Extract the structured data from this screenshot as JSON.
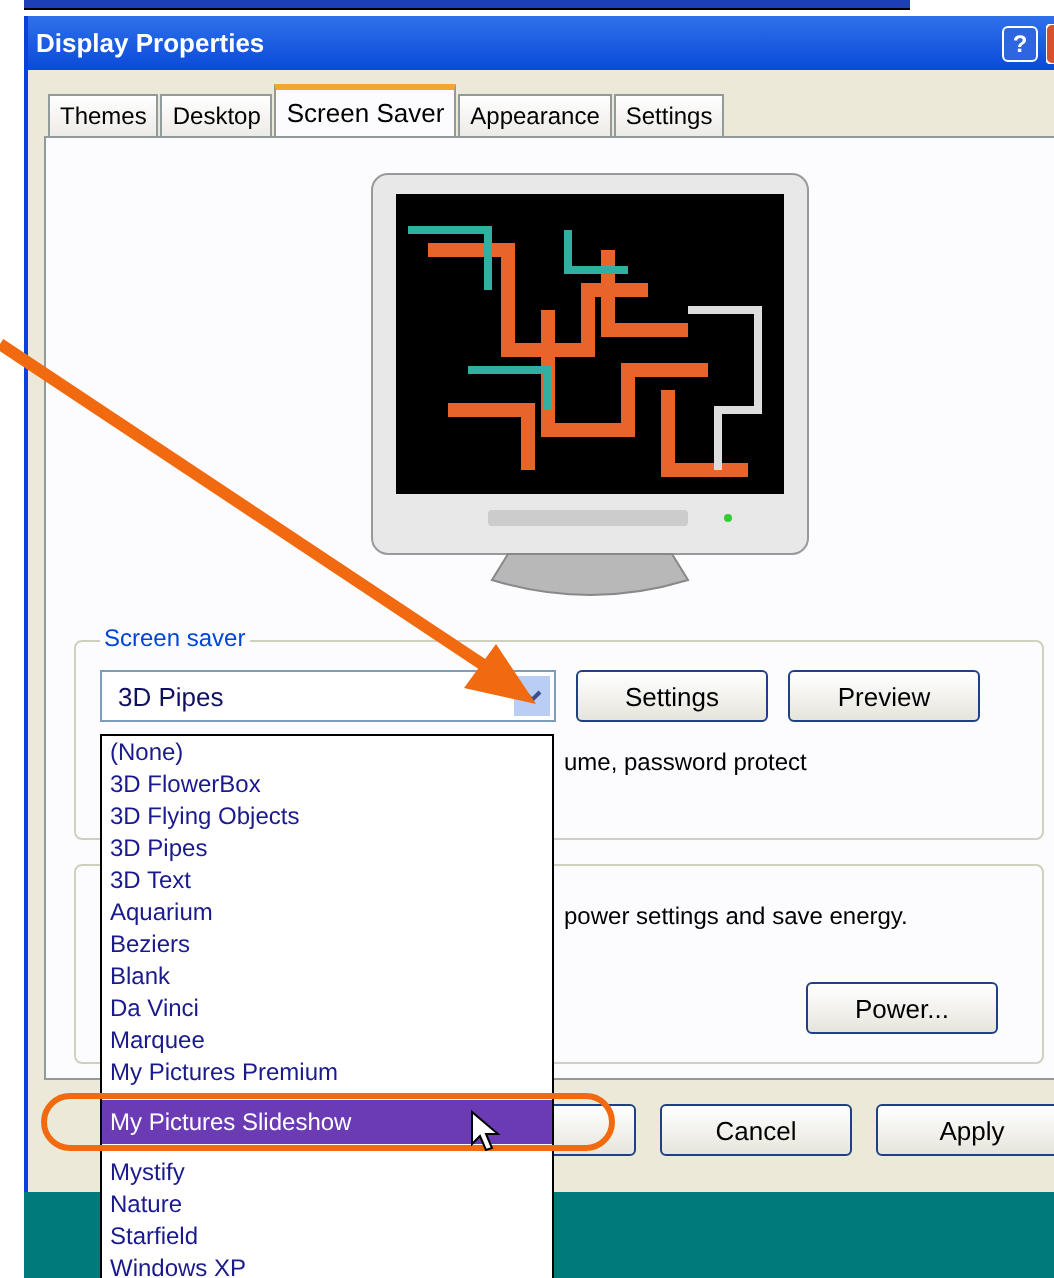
{
  "window": {
    "title": "Display Properties",
    "help_button": "?"
  },
  "tabs": [
    {
      "label": "Themes",
      "selected": false
    },
    {
      "label": "Desktop",
      "selected": false
    },
    {
      "label": "Screen Saver",
      "selected": true
    },
    {
      "label": "Appearance",
      "selected": false
    },
    {
      "label": "Settings",
      "selected": false
    }
  ],
  "screen_saver": {
    "group_label": "Screen saver",
    "value": "3D Pipes",
    "buttons": [
      "Settings",
      "Preview"
    ],
    "hint_text": "ume, password protect"
  },
  "dropdown_list": [
    {
      "label": "(None)",
      "selected": false
    },
    {
      "label": "3D FlowerBox",
      "selected": false
    },
    {
      "label": "3D Flying Objects",
      "selected": false
    },
    {
      "label": "3D Pipes",
      "selected": false
    },
    {
      "label": "3D Text",
      "selected": false
    },
    {
      "label": "Aquarium",
      "selected": false
    },
    {
      "label": "Beziers",
      "selected": false
    },
    {
      "label": "Blank",
      "selected": false
    },
    {
      "label": "Da Vinci",
      "selected": false
    },
    {
      "label": "Marquee",
      "selected": false
    },
    {
      "label": "My Pictures Premium",
      "selected": false
    },
    {
      "label": "My Pictures Slideshow",
      "selected": true
    },
    {
      "label": "Mystify",
      "selected": false
    },
    {
      "label": "Nature",
      "selected": false
    },
    {
      "label": "Starfield",
      "selected": false
    },
    {
      "label": "Windows XP",
      "selected": false
    }
  ],
  "power": {
    "text": "power settings and save energy.",
    "button": "Power..."
  },
  "dialog_buttons": [
    "Cancel",
    "Apply"
  ]
}
